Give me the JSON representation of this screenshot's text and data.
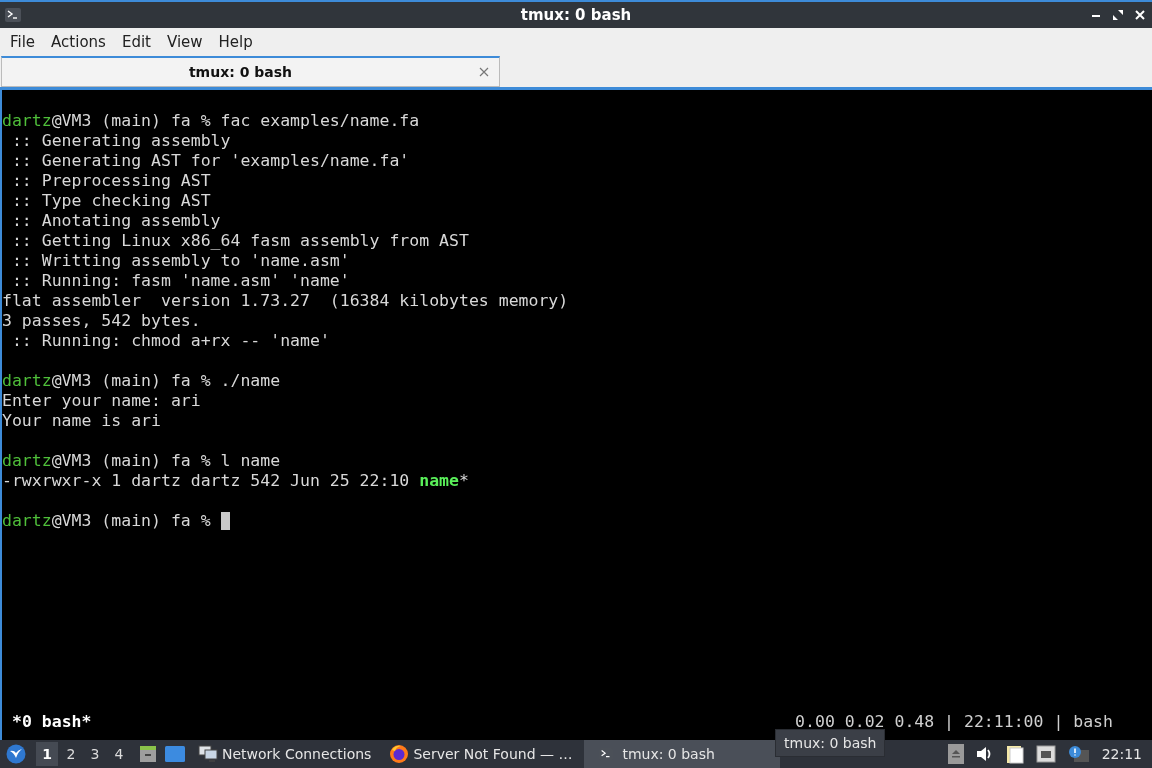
{
  "window": {
    "title": "tmux: 0 bash"
  },
  "menu": [
    "File",
    "Actions",
    "Edit",
    "View",
    "Help"
  ],
  "tabs": [
    {
      "label": "tmux: 0 bash",
      "selected": true
    }
  ],
  "terminal": {
    "blocks": [
      [
        [
          {
            "kind": "user",
            "text": "dartz"
          },
          {
            "kind": "plain",
            "text": "@VM3 (main) fa % fac examples/name.fa"
          }
        ],
        [
          {
            "kind": "plain",
            "text": " :: Generating assembly"
          }
        ],
        [
          {
            "kind": "plain",
            "text": " :: Generating AST for 'examples/name.fa'"
          }
        ],
        [
          {
            "kind": "plain",
            "text": " :: Preprocessing AST"
          }
        ],
        [
          {
            "kind": "plain",
            "text": " :: Type checking AST"
          }
        ],
        [
          {
            "kind": "plain",
            "text": " :: Anotating assembly"
          }
        ],
        [
          {
            "kind": "plain",
            "text": " :: Getting Linux x86_64 fasm assembly from AST"
          }
        ],
        [
          {
            "kind": "plain",
            "text": " :: Writting assembly to 'name.asm'"
          }
        ],
        [
          {
            "kind": "plain",
            "text": " :: Running: fasm 'name.asm' 'name'"
          }
        ],
        [
          {
            "kind": "plain",
            "text": "flat assembler  version 1.73.27  (16384 kilobytes memory)"
          }
        ],
        [
          {
            "kind": "plain",
            "text": "3 passes, 542 bytes."
          }
        ],
        [
          {
            "kind": "plain",
            "text": " :: Running: chmod a+rx -- 'name'"
          }
        ]
      ],
      [
        [
          {
            "kind": "user",
            "text": "dartz"
          },
          {
            "kind": "plain",
            "text": "@VM3 (main) fa % ./name"
          }
        ],
        [
          {
            "kind": "plain",
            "text": "Enter your name: ari"
          }
        ],
        [
          {
            "kind": "plain",
            "text": "Your name is ari"
          }
        ]
      ],
      [
        [
          {
            "kind": "user",
            "text": "dartz"
          },
          {
            "kind": "plain",
            "text": "@VM3 (main) fa % l name"
          }
        ],
        [
          {
            "kind": "plain",
            "text": "-rwxrwxr-x 1 dartz dartz 542 Jun 25 22:10 "
          },
          {
            "kind": "exec",
            "text": "name"
          },
          {
            "kind": "plain",
            "text": "*"
          }
        ]
      ],
      [
        [
          {
            "kind": "user",
            "text": "dartz"
          },
          {
            "kind": "plain",
            "text": "@VM3 (main) fa % "
          }
        ]
      ]
    ]
  },
  "tmux_status": {
    "left": "*0 bash*",
    "right": "0.00 0.02 0.48 | 22:11:00 | bash"
  },
  "taskbar": {
    "desktops": [
      {
        "label": "1",
        "selected": true
      },
      {
        "label": "2",
        "selected": false
      },
      {
        "label": "3",
        "selected": false
      },
      {
        "label": "4",
        "selected": false
      }
    ],
    "tasks": [
      {
        "kind": "network",
        "label": "Network Connections",
        "selected": false
      },
      {
        "kind": "browser",
        "label": "Server Not Found — …",
        "selected": false
      },
      {
        "kind": "terminal",
        "label": "tmux: 0 bash",
        "selected": true
      }
    ],
    "clock": "22:11"
  },
  "tooltip": "tmux: 0 bash"
}
